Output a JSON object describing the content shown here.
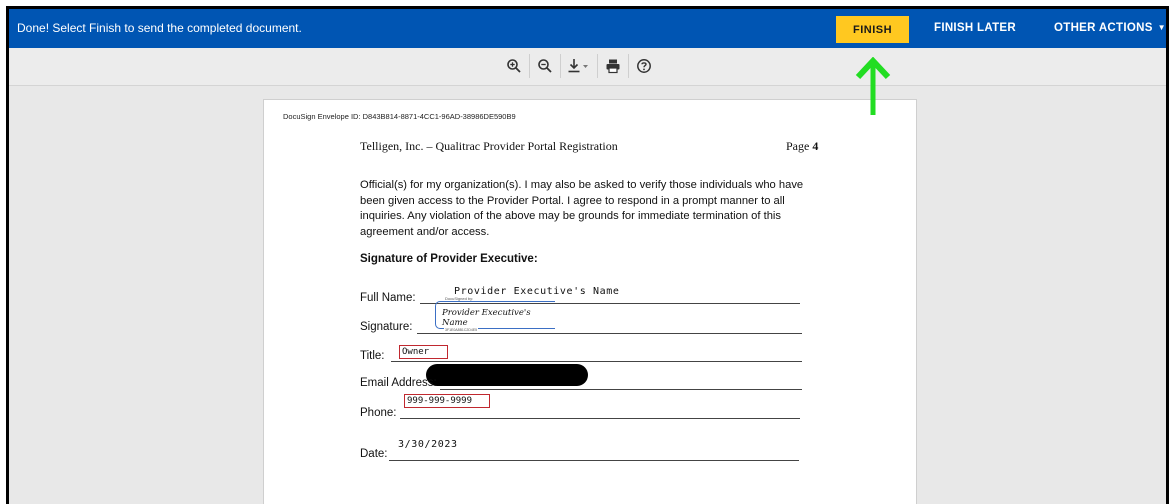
{
  "topbar": {
    "message": "Done! Select Finish to send the completed document.",
    "finish_label": "FINISH",
    "finish_later_label": "FINISH LATER",
    "other_actions_label": "OTHER ACTIONS",
    "accent_color": "#0055b3",
    "finish_color": "#ffc820"
  },
  "toolbar": {
    "tools": [
      "zoom-in-icon",
      "zoom-out-icon",
      "download-icon",
      "print-icon",
      "help-icon"
    ]
  },
  "document": {
    "envelope_id": "DocuSign Envelope ID: D843B814-8871-4CC1-96AD-38986DE590B9",
    "header_left": "Telligen, Inc. – Qualitrac Provider Portal Registration",
    "header_page_label": "Page",
    "header_page_number": "4",
    "paragraph": "Official(s) for my organization(s). I may also be asked to verify those individuals who have been given access to the Provider Portal.  I agree to respond in a prompt manner to all inquiries. Any violation of the above may be grounds for immediate termination of this agreement and/or access.",
    "signature_heading": "Signature of Provider Executive:",
    "full_name_label": "Full Name:",
    "full_name_value": "Provider Executive's Name",
    "signature_label": "Signature:",
    "signature_stamp_top": "DocuSigned by:",
    "signature_value": "Provider Executive's Name",
    "signature_stamp_bottom": "3F1E0A8B1C2D4E5",
    "title_label": "Title:",
    "title_value": "Owner",
    "email_label": "Email Address:",
    "phone_label": "Phone:",
    "phone_value": "999-999-9999",
    "date_label": "Date:",
    "date_value": "3/30/2023"
  },
  "annotation": {
    "arrow_color": "#22dd22"
  }
}
